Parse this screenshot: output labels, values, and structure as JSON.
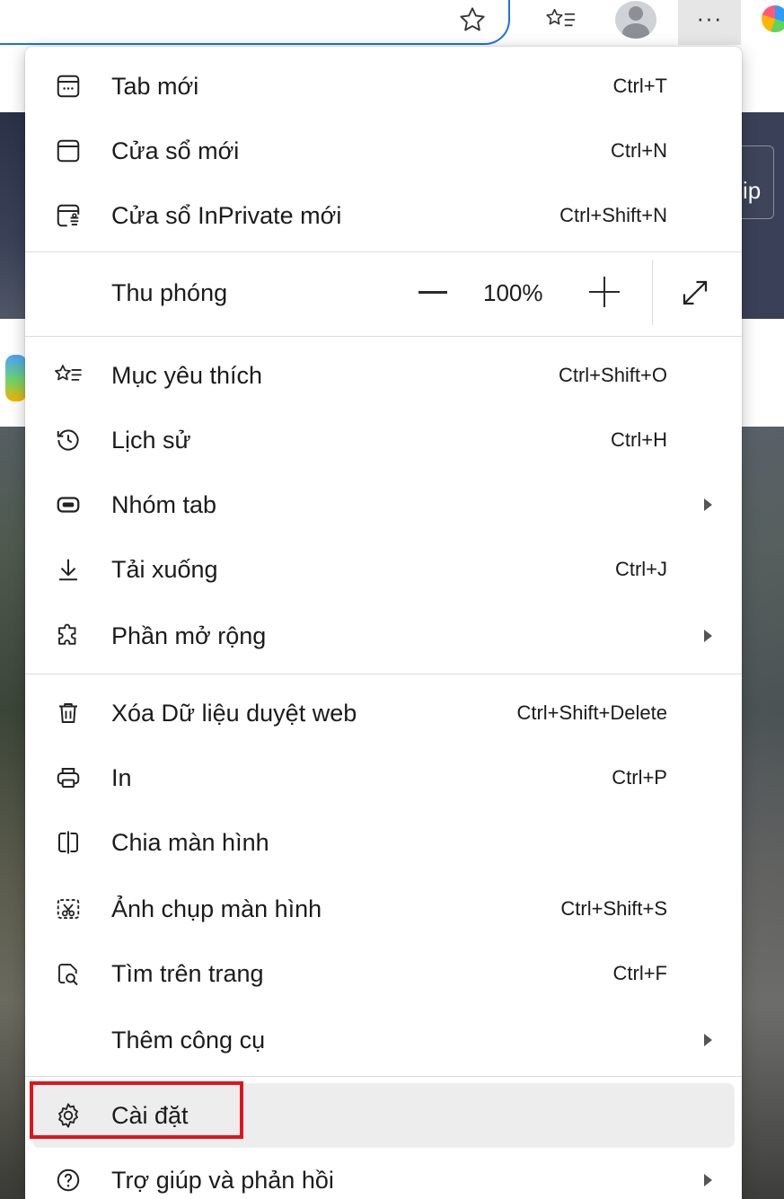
{
  "background": {
    "right_button_text": "ip"
  },
  "toolbar": {
    "icons": [
      "star-icon",
      "favorites-list-icon",
      "profile-avatar",
      "more-options-icon",
      "edge-copilot-icon"
    ],
    "more_label": "···"
  },
  "menu": {
    "items": [
      {
        "icon": "new-tab-icon",
        "label": "Tab mới",
        "shortcut": "Ctrl+T"
      },
      {
        "icon": "new-window-icon",
        "label": "Cửa sổ mới",
        "shortcut": "Ctrl+N"
      },
      {
        "icon": "inprivate-icon",
        "label": "Cửa sổ InPrivate mới",
        "shortcut": "Ctrl+Shift+N"
      },
      {
        "icon": "favorites-icon",
        "label": "Mục yêu thích",
        "shortcut": "Ctrl+Shift+O"
      },
      {
        "icon": "history-icon",
        "label": "Lịch sử",
        "shortcut": "Ctrl+H"
      },
      {
        "icon": "tab-groups-icon",
        "label": "Nhóm tab",
        "shortcut": "",
        "submenu": true
      },
      {
        "icon": "download-icon",
        "label": "Tải xuống",
        "shortcut": "Ctrl+J"
      },
      {
        "icon": "extensions-icon",
        "label": "Phần mở rộng",
        "shortcut": "",
        "submenu": true
      },
      {
        "icon": "trash-icon",
        "label": "Xóa Dữ liệu duyệt web",
        "shortcut": "Ctrl+Shift+Delete"
      },
      {
        "icon": "print-icon",
        "label": "In",
        "shortcut": "Ctrl+P"
      },
      {
        "icon": "split-screen-icon",
        "label": "Chia màn hình",
        "shortcut": ""
      },
      {
        "icon": "screenshot-icon",
        "label": "Ảnh chụp màn hình",
        "shortcut": "Ctrl+Shift+S"
      },
      {
        "icon": "find-icon",
        "label": "Tìm trên trang",
        "shortcut": "Ctrl+F"
      },
      {
        "icon": "",
        "label": "Thêm công cụ",
        "shortcut": "",
        "submenu": true
      },
      {
        "icon": "gear-icon",
        "label": "Cài đặt",
        "shortcut": "",
        "highlighted": true
      },
      {
        "icon": "help-icon",
        "label": "Trợ giúp và phản hồi",
        "shortcut": "",
        "submenu": true
      }
    ],
    "zoom": {
      "label": "Thu phóng",
      "value": "100%"
    }
  },
  "colors": {
    "highlight_border": "#e0141e",
    "highlight_background": "#ededed",
    "accent": "#1a73e8"
  }
}
